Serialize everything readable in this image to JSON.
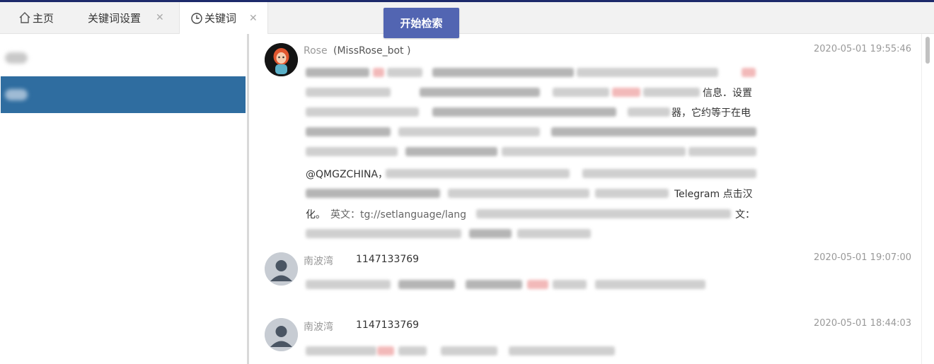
{
  "tabs": {
    "home_label": "主页",
    "settings_label": "关键词设置",
    "keywords_label": "关键词",
    "close_glyph": "✕"
  },
  "toolbar": {
    "search_button_label": "开始检索"
  },
  "colors": {
    "accent": "#5265b2",
    "sidebar_selected": "#2f6da0",
    "top_border": "#1d2a6b"
  },
  "messages": [
    {
      "sender": "Rose",
      "sender_id": "(MissRose_bot )",
      "timestamp": "2020-05-01 19:55:46",
      "visible_fragments": {
        "line2_end": "信息．设置",
        "line3_end": "器，它约等于在电",
        "mention": "@QMGZCHINA，",
        "telegram": "Telegram 点击汉",
        "line8_start": "化。",
        "line8_mid": "英文：tg://setlanguage/lang",
        "line8_end": "文："
      }
    },
    {
      "sender": "南波湾",
      "sender_id": "1147133769",
      "timestamp": "2020-05-01 19:07:00"
    },
    {
      "sender": "南波湾",
      "sender_id": "1147133769",
      "timestamp": "2020-05-01 18:44:03"
    }
  ],
  "icons": {
    "home": "home-icon",
    "clock": "clock-icon",
    "close": "close-icon",
    "avatar_default": "user-avatar-icon"
  }
}
